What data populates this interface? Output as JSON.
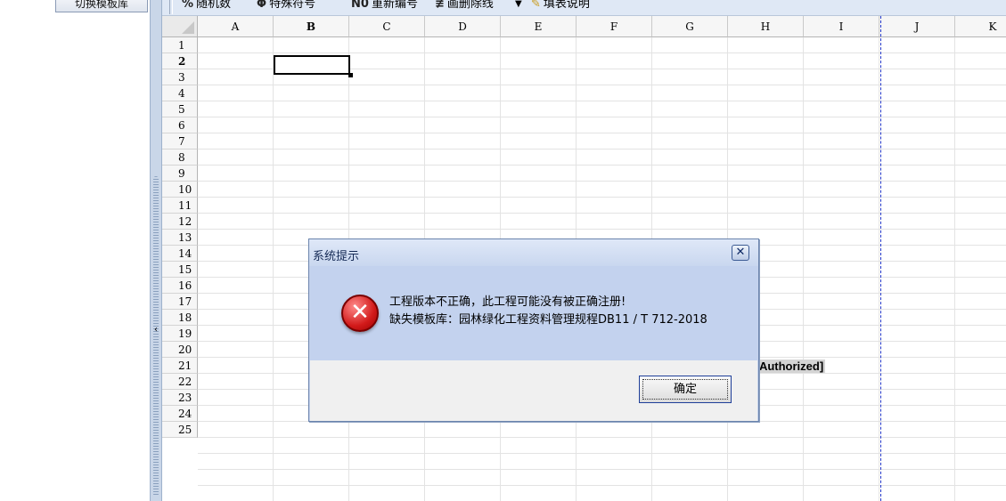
{
  "left_panel": {
    "switch_button": "切换模板库"
  },
  "toolbar": {
    "items": [
      {
        "icon": "%",
        "label": "随机数"
      },
      {
        "icon": "Φ",
        "label": "特殊符号"
      },
      {
        "icon": "N0",
        "label": "重新编号"
      },
      {
        "icon": "≢",
        "label": "画删除线"
      },
      {
        "icon": "▼",
        "label": ""
      },
      {
        "icon": "✎",
        "label": "填表说明"
      }
    ]
  },
  "sheet": {
    "columns": [
      "A",
      "B",
      "C",
      "D",
      "E",
      "F",
      "G",
      "H",
      "I",
      "J",
      "K"
    ],
    "selected_column": "B",
    "rows": [
      "1",
      "2",
      "3",
      "4",
      "5",
      "6",
      "7",
      "8",
      "9",
      "10",
      "11",
      "12",
      "13",
      "14",
      "15",
      "16",
      "17",
      "18",
      "19",
      "20",
      "21",
      "22",
      "23",
      "24",
      "25"
    ],
    "selected_row": "2",
    "background_text": "nAuthorized]"
  },
  "dialog": {
    "title": "系统提示",
    "close_glyph": "✕",
    "icon": "error-icon",
    "message_line1": "工程版本不正确，此工程可能没有被正确注册!",
    "message_line2": "缺失模板库：园林绿化工程资料管理规程DB11 / T 712-2018",
    "ok_label": "确定"
  },
  "colors": {
    "toolbar_bg": "#dfe8f5",
    "dialog_bg": "#c6d3ec",
    "page_break": "#2236c8"
  }
}
